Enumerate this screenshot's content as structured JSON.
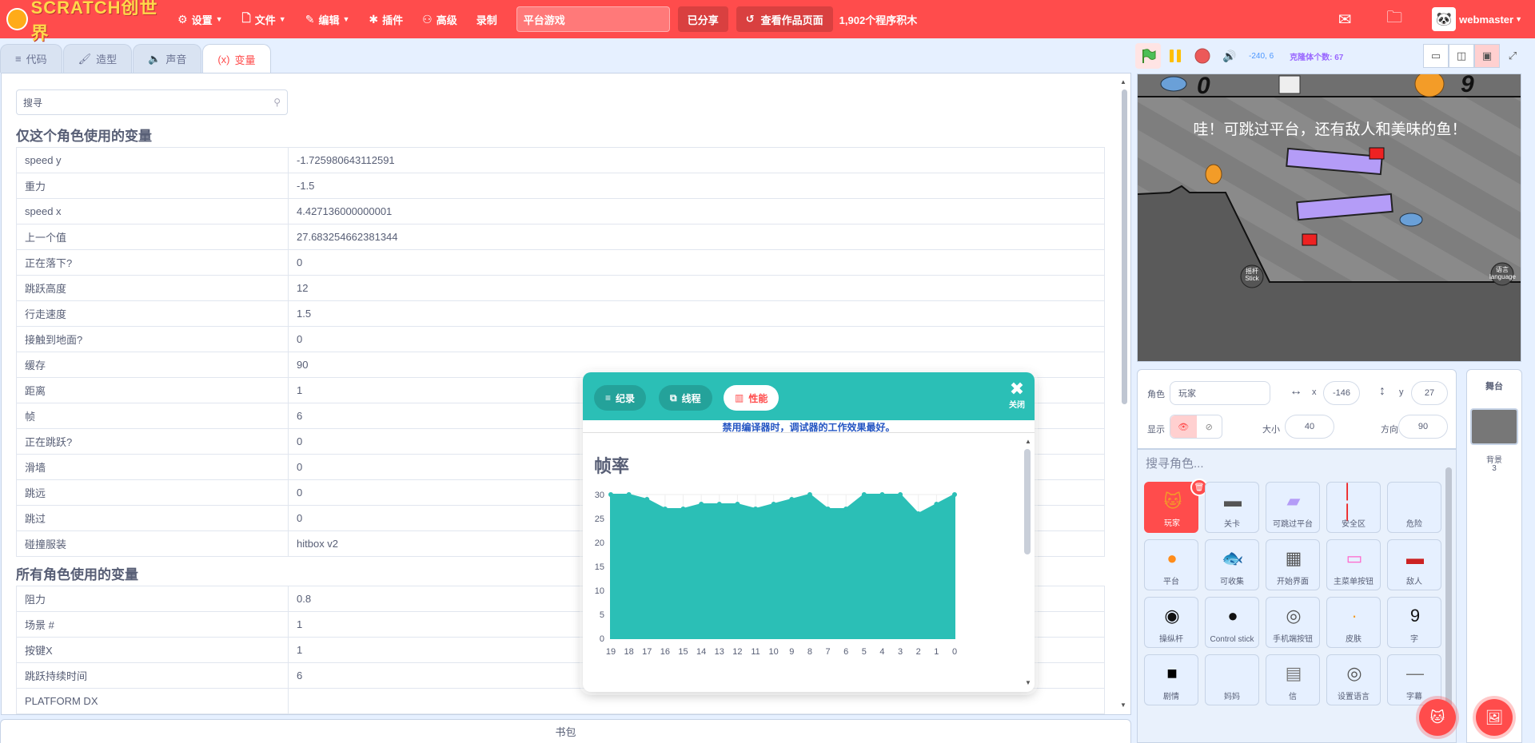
{
  "topbar": {
    "logo_text": "SCRATCH创世界",
    "menus": [
      {
        "icon": "gear-icon",
        "label": "设置",
        "caret": true
      },
      {
        "icon": "file-icon",
        "label": "文件",
        "caret": true
      },
      {
        "icon": "pencil-icon",
        "label": "编辑",
        "caret": true
      },
      {
        "icon": "puzzle-icon",
        "label": "插件",
        "caret": false
      },
      {
        "icon": "advanced-icon",
        "label": "高级",
        "caret": false
      },
      {
        "icon": "",
        "label": "录制",
        "caret": false
      }
    ],
    "project_title": "平台游戏",
    "shared_label": "已分享",
    "see_project_label": "查看作品页面",
    "blocks_count": "1,902个程序积木",
    "username": "webmaster"
  },
  "tabs": [
    {
      "icon": "code-icon",
      "label": "代码",
      "active": false
    },
    {
      "icon": "costume-icon",
      "label": "造型",
      "active": false
    },
    {
      "icon": "sound-icon",
      "label": "声音",
      "active": false
    },
    {
      "icon": "variable-icon",
      "label": "变量",
      "active": true,
      "icon_text": "(x)"
    }
  ],
  "variables": {
    "search_placeholder": "搜寻",
    "local_title": "仅这个角色使用的变量",
    "local": [
      {
        "name": "speed y",
        "value": "-1.725980643112591"
      },
      {
        "name": "重力",
        "value": "-1.5"
      },
      {
        "name": "speed x",
        "value": "4.427136000000001"
      },
      {
        "name": "上一个值",
        "value": "27.683254662381344"
      },
      {
        "name": "正在落下?",
        "value": "0"
      },
      {
        "name": "跳跃高度",
        "value": "12"
      },
      {
        "name": "行走速度",
        "value": "1.5"
      },
      {
        "name": "接触到地面?",
        "value": "0"
      },
      {
        "name": "缓存",
        "value": "90"
      },
      {
        "name": "距离",
        "value": "1"
      },
      {
        "name": "帧",
        "value": "6"
      },
      {
        "name": "正在跳跃?",
        "value": "0"
      },
      {
        "name": "滑墙",
        "value": "0"
      },
      {
        "name": "跳远",
        "value": "0"
      },
      {
        "name": "跳过",
        "value": "0"
      },
      {
        "name": "碰撞服装",
        "value": "hitbox v2"
      }
    ],
    "global_title": "所有角色使用的变量",
    "global": [
      {
        "name": "阻力",
        "value": "0.8"
      },
      {
        "name": "场景 #",
        "value": "1"
      },
      {
        "name": "按键X",
        "value": "1"
      },
      {
        "name": "跳跃持续时间",
        "value": "6"
      },
      {
        "name": "PLATFORM DX",
        "value": ""
      }
    ]
  },
  "backpack_label": "书包",
  "stage_controls": {
    "coords": "-240, 6",
    "clone_count": "克隆体个数: 67"
  },
  "stage": {
    "score_left": "0",
    "score_right": "9",
    "message": "哇！可跳过平台，还有敌人和美味的鱼！",
    "stick_label": "摇杆\nStick",
    "lang_label": "语言\nlanguage"
  },
  "sprite_info": {
    "sprite_label": "角色",
    "sprite_name": "玩家",
    "x_label": "x",
    "x_value": "-146",
    "y_label": "y",
    "y_value": "27",
    "show_label": "显示",
    "size_label": "大小",
    "size_value": "40",
    "direction_label": "方向",
    "direction_value": "90"
  },
  "sprite_search": "搜寻角色...",
  "sprites": [
    {
      "name": "玩家",
      "selected": true
    },
    {
      "name": "关卡",
      "selected": false
    },
    {
      "name": "可跳过平台",
      "selected": false
    },
    {
      "name": "安全区",
      "selected": false
    },
    {
      "name": "危险",
      "selected": false
    },
    {
      "name": "平台",
      "selected": false
    },
    {
      "name": "可收集",
      "selected": false
    },
    {
      "name": "开始界面",
      "selected": false
    },
    {
      "name": "主菜单按钮",
      "selected": false
    },
    {
      "name": "敌人",
      "selected": false
    },
    {
      "name": "操纵杆",
      "selected": false
    },
    {
      "name": "Control stick",
      "selected": false
    },
    {
      "name": "手机端按钮",
      "selected": false
    },
    {
      "name": "皮肤",
      "selected": false
    },
    {
      "name": "字",
      "selected": false
    },
    {
      "name": "剧情",
      "selected": false
    },
    {
      "name": "妈妈",
      "selected": false
    },
    {
      "name": "信",
      "selected": false
    },
    {
      "name": "设置语言",
      "selected": false
    },
    {
      "name": "字幕",
      "selected": false
    }
  ],
  "stage_pane": {
    "title": "舞台",
    "backdrop_label": "背景",
    "backdrop_count": "3"
  },
  "debugger": {
    "tabs": [
      {
        "icon": "log-icon",
        "label": "纪录",
        "active": false
      },
      {
        "icon": "threads-icon",
        "label": "线程",
        "active": false
      },
      {
        "icon": "performance-icon",
        "label": "性能",
        "active": true
      }
    ],
    "close_label": "关闭",
    "note": "禁用编译器时，调试器的工作效果最好。",
    "chart_title": "帧率"
  },
  "chart_data": {
    "type": "area",
    "title": "帧率",
    "x": [
      19,
      18,
      17,
      16,
      15,
      14,
      13,
      12,
      11,
      10,
      9,
      8,
      7,
      6,
      5,
      4,
      3,
      2,
      1,
      0
    ],
    "values": [
      30,
      30,
      29,
      27,
      27,
      28,
      28,
      28,
      27,
      28,
      29,
      30,
      27,
      27,
      30,
      30,
      30,
      26,
      28,
      30
    ],
    "ylim": [
      0,
      30
    ],
    "yticks": [
      0,
      5,
      10,
      15,
      20,
      25,
      30
    ],
    "color": "#2bbfb6",
    "grid": true
  },
  "colors": {
    "accent": "#ff4c4c",
    "teal": "#2bbfb6",
    "link_blue": "#4c97ff"
  }
}
